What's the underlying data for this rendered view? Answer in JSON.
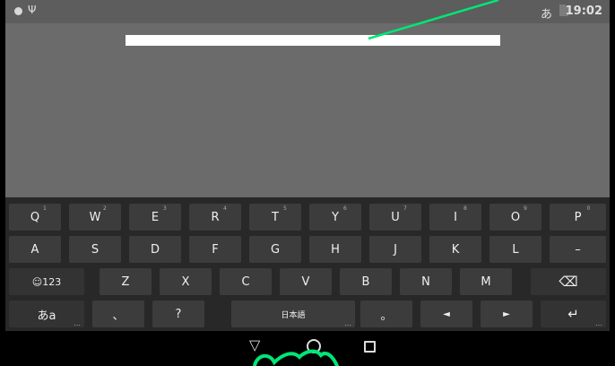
{
  "status_bar": {
    "usb_icon": "Ψ",
    "ime_indicator": "あ",
    "time": "19:02"
  },
  "keyboard": {
    "row1": [
      {
        "label": "Q",
        "hint": "1"
      },
      {
        "label": "W",
        "hint": "2"
      },
      {
        "label": "E",
        "hint": "3"
      },
      {
        "label": "R",
        "hint": "4"
      },
      {
        "label": "T",
        "hint": "5"
      },
      {
        "label": "Y",
        "hint": "6"
      },
      {
        "label": "U",
        "hint": "7"
      },
      {
        "label": "I",
        "hint": "8"
      },
      {
        "label": "O",
        "hint": "9"
      },
      {
        "label": "P",
        "hint": "0"
      }
    ],
    "row2": [
      "A",
      "S",
      "D",
      "F",
      "G",
      "H",
      "J",
      "K",
      "L",
      "–"
    ],
    "row3": {
      "symbols_label": "☺123",
      "letters": [
        "Z",
        "X",
        "C",
        "V",
        "B",
        "N",
        "M"
      ],
      "backspace_icon": "⌫"
    },
    "row4": {
      "mode_label": "あa",
      "comma": "、",
      "question": "?",
      "space_label": "日本語",
      "period": "。",
      "left_arrow": "◄",
      "right_arrow": "►",
      "enter_icon": "↵"
    }
  },
  "nav_bar": {
    "back_icon": "▽"
  },
  "colors": {
    "annotation_green": "#00e676",
    "screen_gray": "#6b6b6b",
    "keyboard_bg": "#282828",
    "key_bg": "#3c3c3c"
  }
}
